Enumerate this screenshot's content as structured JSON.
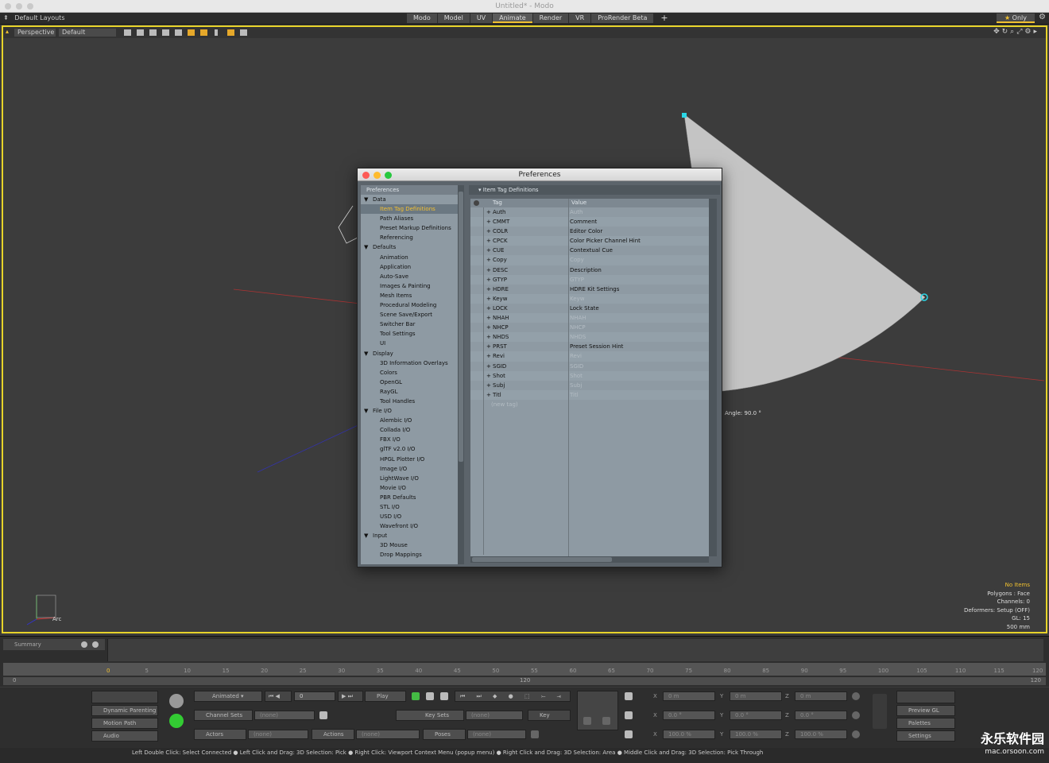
{
  "window": {
    "title": "Untitled* - Modo"
  },
  "menubar": {
    "layouts_label": "Default Layouts",
    "tabs": [
      "Modo",
      "Model",
      "UV",
      "Animate",
      "Render",
      "VR",
      "ProRender Beta"
    ],
    "add_tab": "+",
    "only_label": "Only"
  },
  "viewport": {
    "view_label": "Perspective",
    "shading_label": "Default",
    "angle_label": "Angle: 90.0 °",
    "arc_label": "Arc",
    "stats": {
      "items": "No Items",
      "polygons": "Polygons : Face",
      "channels": "Channels: 0",
      "deformers": "Deformers: Setup (OFF)",
      "gl": "GL: 15",
      "scale": "500 mm"
    }
  },
  "preferences": {
    "title": "Preferences",
    "tree_header": "Preferences",
    "tree": [
      {
        "label": "Data",
        "level": 0
      },
      {
        "label": "Item Tag Definitions",
        "level": 1,
        "selected": true
      },
      {
        "label": "Path Aliases",
        "level": 1
      },
      {
        "label": "Preset Markup Definitions",
        "level": 1
      },
      {
        "label": "Referencing",
        "level": 1
      },
      {
        "label": "Defaults",
        "level": 0
      },
      {
        "label": "Animation",
        "level": 1
      },
      {
        "label": "Application",
        "level": 1
      },
      {
        "label": "Auto-Save",
        "level": 1
      },
      {
        "label": "Images & Painting",
        "level": 1
      },
      {
        "label": "Mesh Items",
        "level": 1
      },
      {
        "label": "Procedural Modeling",
        "level": 1
      },
      {
        "label": "Scene Save/Export",
        "level": 1
      },
      {
        "label": "Switcher Bar",
        "level": 1
      },
      {
        "label": "Tool Settings",
        "level": 1
      },
      {
        "label": "UI",
        "level": 1
      },
      {
        "label": "Display",
        "level": 0
      },
      {
        "label": "3D Information Overlays",
        "level": 1
      },
      {
        "label": "Colors",
        "level": 1
      },
      {
        "label": "OpenGL",
        "level": 1
      },
      {
        "label": "RayGL",
        "level": 1
      },
      {
        "label": "Tool Handles",
        "level": 1
      },
      {
        "label": "File I/O",
        "level": 0
      },
      {
        "label": "Alembic I/O",
        "level": 1
      },
      {
        "label": "Collada I/O",
        "level": 1
      },
      {
        "label": "FBX I/O",
        "level": 1
      },
      {
        "label": "glTF v2.0 I/O",
        "level": 1
      },
      {
        "label": "HPGL Plotter I/O",
        "level": 1
      },
      {
        "label": "Image I/O",
        "level": 1
      },
      {
        "label": "LightWave I/O",
        "level": 1
      },
      {
        "label": "Movie I/O",
        "level": 1
      },
      {
        "label": "PBR Defaults",
        "level": 1
      },
      {
        "label": "STL I/O",
        "level": 1
      },
      {
        "label": "USD I/O",
        "level": 1
      },
      {
        "label": "Wavefront I/O",
        "level": 1
      },
      {
        "label": "Input",
        "level": 0
      },
      {
        "label": "3D Mouse",
        "level": 1
      },
      {
        "label": "Drop Mappings",
        "level": 1
      }
    ],
    "panel_header": "Item Tag Definitions",
    "columns": {
      "tag": "Tag",
      "value": "Value"
    },
    "rows": [
      {
        "tag": "Auth",
        "value": "Auth",
        "dim": true
      },
      {
        "tag": "CMMT",
        "value": "Comment",
        "dim": false
      },
      {
        "tag": "COLR",
        "value": "Editor Color",
        "dim": false
      },
      {
        "tag": "CPCK",
        "value": "Color Picker Channel Hint",
        "dim": false
      },
      {
        "tag": "CUE",
        "value": "Contextual Cue",
        "dim": false
      },
      {
        "tag": "Copy",
        "value": "Copy",
        "dim": true
      },
      {
        "tag": "DESC",
        "value": "Description",
        "dim": false
      },
      {
        "tag": "GTYP",
        "value": "GTYP",
        "dim": true
      },
      {
        "tag": "HDRE",
        "value": "HDRE Kit Settings",
        "dim": false
      },
      {
        "tag": "Keyw",
        "value": "Keyw",
        "dim": true
      },
      {
        "tag": "LOCK",
        "value": "Lock State",
        "dim": false
      },
      {
        "tag": "NHAH",
        "value": "NHAH",
        "dim": true
      },
      {
        "tag": "NHCP",
        "value": "NHCP",
        "dim": true
      },
      {
        "tag": "NHDS",
        "value": "NHDS",
        "dim": true
      },
      {
        "tag": "PRST",
        "value": "Preset Session Hint",
        "dim": false
      },
      {
        "tag": "Revi",
        "value": "Revi",
        "dim": true
      },
      {
        "tag": "SGID",
        "value": "SGID",
        "dim": true
      },
      {
        "tag": "Shot",
        "value": "Shot",
        "dim": true
      },
      {
        "tag": "Subj",
        "value": "Subj",
        "dim": true
      },
      {
        "tag": "Titl",
        "value": "Titl",
        "dim": true
      }
    ],
    "new_tag_label": "(new tag)"
  },
  "timeline": {
    "summary_label": "Summary",
    "ticks": [
      "0",
      "5",
      "10",
      "15",
      "20",
      "25",
      "30",
      "35",
      "40",
      "45",
      "50",
      "55",
      "60",
      "65",
      "70",
      "75",
      "80",
      "85",
      "90",
      "95",
      "100",
      "105",
      "110",
      "115",
      "120"
    ],
    "range_start": "0",
    "range_mid": "120",
    "range_end": "120"
  },
  "controls": {
    "dynamic_parenting": "Dynamic Parenting",
    "motion_path": "Motion Path",
    "audio": "Audio",
    "animated": "Animated",
    "frame_value": "0",
    "play": "Play",
    "channel_sets": "Channel Sets",
    "channel_sets_value": "(none)",
    "key_sets": "Key Sets",
    "key_sets_value": "(none)",
    "key_label": "Key",
    "actors": "Actors",
    "actors_value": "(none)",
    "actions": "Actions",
    "actions_value": "(none)",
    "poses": "Poses",
    "poses_value": "(none)",
    "pos_x": "0 m",
    "pos_y": "0 m",
    "pos_z": "0 m",
    "rot_x": "0.0 °",
    "rot_y": "0.0 °",
    "rot_z": "0.0 °",
    "scl_x": "100.0 %",
    "scl_y": "100.0 %",
    "scl_z": "100.0 %",
    "x_lbl": "X",
    "y_lbl": "Y",
    "z_lbl": "Z",
    "preview_gl": "Preview GL",
    "palettes": "Palettes",
    "settings": "Settings"
  },
  "status": {
    "text": "Left Double Click: Select Connected ● Left Click and Drag: 3D Selection: Pick ● Right Click: Viewport Context Menu (popup menu) ● Right Click and Drag: 3D Selection: Area ● Middle Click and Drag: 3D Selection: Pick Through"
  },
  "watermark": {
    "brand": "永乐软件园",
    "url": "mac.orsoon.com"
  },
  "colors": {
    "accent": "#e7d32a",
    "selection": "#f4c030",
    "dialog": "#8e9aa3"
  }
}
